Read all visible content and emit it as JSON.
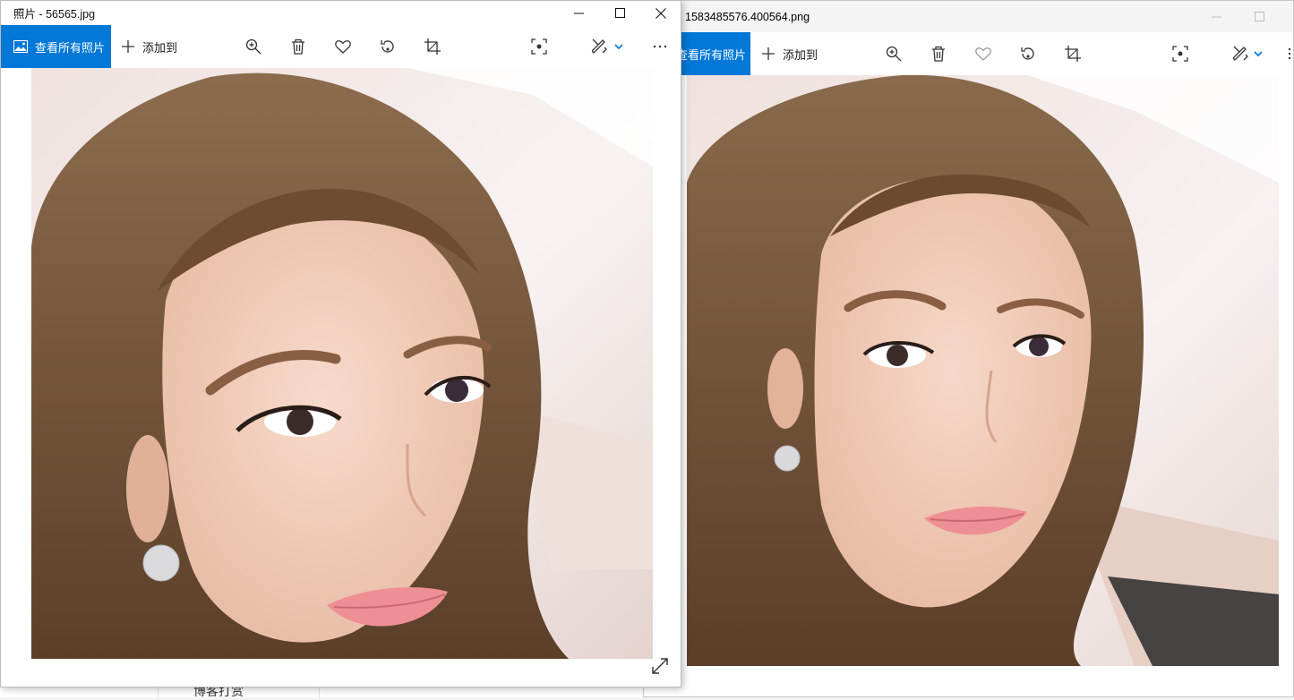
{
  "background_page": {
    "snippet_text": "博客打赏"
  },
  "left_window": {
    "title": "照片 - 56565.jpg",
    "toolbar": {
      "see_all_label": "查看所有照片",
      "add_to_label": "添加到",
      "icons": [
        "zoom-in-icon",
        "delete-icon",
        "favorite-icon",
        "rotate-icon",
        "crop-icon",
        "visual-search-icon",
        "edit-create-icon",
        "more-icon"
      ]
    },
    "caption_buttons": [
      "minimize",
      "maximize",
      "close"
    ]
  },
  "right_window": {
    "title": "1583485576.400564.png",
    "toolbar": {
      "see_all_label": "查看所有照片",
      "add_to_label": "添加到",
      "icons": [
        "zoom-in-icon",
        "delete-icon",
        "favorite-icon",
        "rotate-icon",
        "crop-icon",
        "visual-search-icon",
        "edit-create-icon",
        "more-icon"
      ]
    }
  },
  "colors": {
    "accent": "#0078d7",
    "hair": "#6b4a30",
    "skin": "#f2cdb8",
    "background_wall": "#f6ecea",
    "lips": "#ee8f95"
  }
}
